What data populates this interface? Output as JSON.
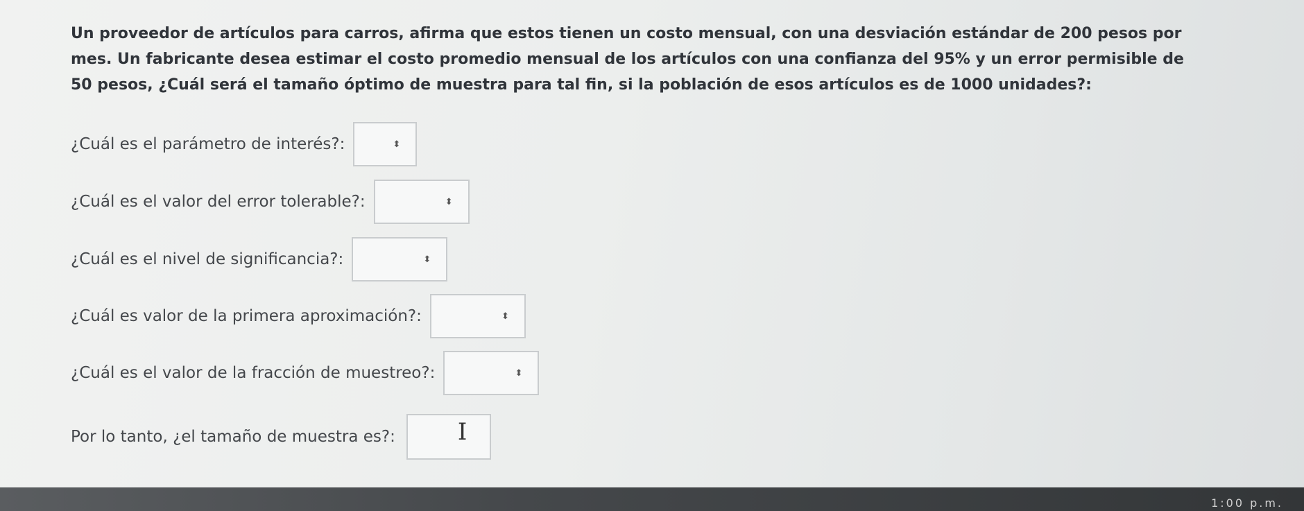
{
  "problem": {
    "line1": "Un proveedor de artículos para carros, afirma que estos tienen un costo mensual, con una desviación estándar de 200 pesos por",
    "line2": "mes. Un fabricante desea estimar el costo promedio mensual de los artículos con una confianza del 95% y un error permisible de",
    "line3": "50 pesos, ¿Cuál será el tamaño óptimo de muestra para tal fin, si la población de esos artículos es de 1000 unidades?:"
  },
  "questions": [
    {
      "label": "¿Cuál es el parámetro de interés?:",
      "arrow": "⬍"
    },
    {
      "label": "¿Cuál es el valor del error tolerable?:",
      "arrow": "⬍"
    },
    {
      "label": "¿Cuál es el nivel de significancia?:",
      "arrow": "⬍"
    },
    {
      "label": "¿Cuál es valor de la primera aproximación?:",
      "arrow": "⬍"
    },
    {
      "label": "¿Cuál es el valor de la fracción de muestreo?:",
      "arrow": "⬍"
    }
  ],
  "final_question": {
    "label": "Por lo tanto, ¿el tamaño de muestra es?:",
    "cursor": "I"
  },
  "corner_text": "1:00 p.m."
}
